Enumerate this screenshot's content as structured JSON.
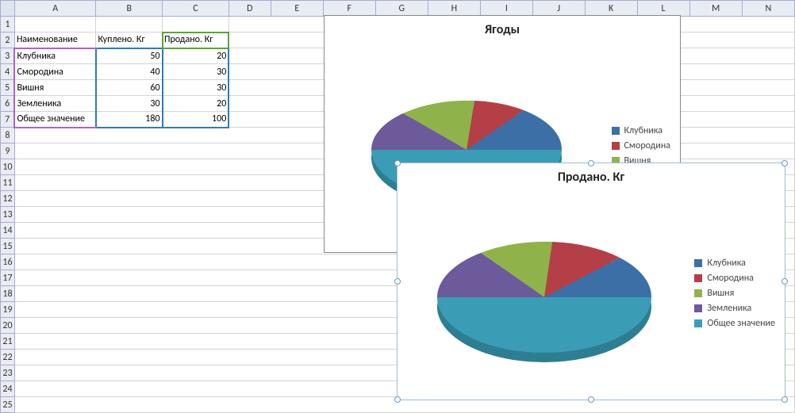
{
  "columns": [
    "A",
    "B",
    "C",
    "D",
    "E",
    "F",
    "G",
    "H",
    "I",
    "J",
    "K",
    "L",
    "M",
    "N"
  ],
  "rows_visible": 25,
  "table": {
    "headers": {
      "name": "Наименование",
      "bought": "Куплено. Кг",
      "sold": "Продано. Кг"
    },
    "rows": [
      {
        "name": "Клубника",
        "bought": 50,
        "sold": 20
      },
      {
        "name": "Смородина",
        "bought": 40,
        "sold": 30
      },
      {
        "name": "Вишня",
        "bought": 60,
        "sold": 30
      },
      {
        "name": "Земленика",
        "bought": 30,
        "sold": 20
      },
      {
        "name": "Общее значение",
        "bought": 180,
        "sold": 100
      }
    ]
  },
  "chart_data": [
    {
      "type": "pie",
      "title": "Ягоды",
      "categories": [
        "Клубника",
        "Смородина",
        "Вишня",
        "Земленика",
        "Общее значение"
      ],
      "values": [
        50,
        40,
        60,
        30,
        180
      ],
      "colors": [
        "#3c6fa6",
        "#b43f47",
        "#8fb34a",
        "#6c5a9b",
        "#3b9db5"
      ],
      "legend_position": "right"
    },
    {
      "type": "pie",
      "title": "Продано. Кг",
      "categories": [
        "Клубника",
        "Смородина",
        "Вишня",
        "Земленика",
        "Общее значение"
      ],
      "values": [
        20,
        30,
        30,
        20,
        100
      ],
      "colors": [
        "#3c6fa6",
        "#b43f47",
        "#8fb34a",
        "#6c5a9b",
        "#3b9db5"
      ],
      "legend_position": "right"
    }
  ],
  "colors": {
    "series": {
      "Клубника": "#3c6fa6",
      "Смородина": "#b43f47",
      "Вишня": "#8fb34a",
      "Земленика": "#6c5a9b",
      "Общее значение": "#3b9db5"
    }
  }
}
